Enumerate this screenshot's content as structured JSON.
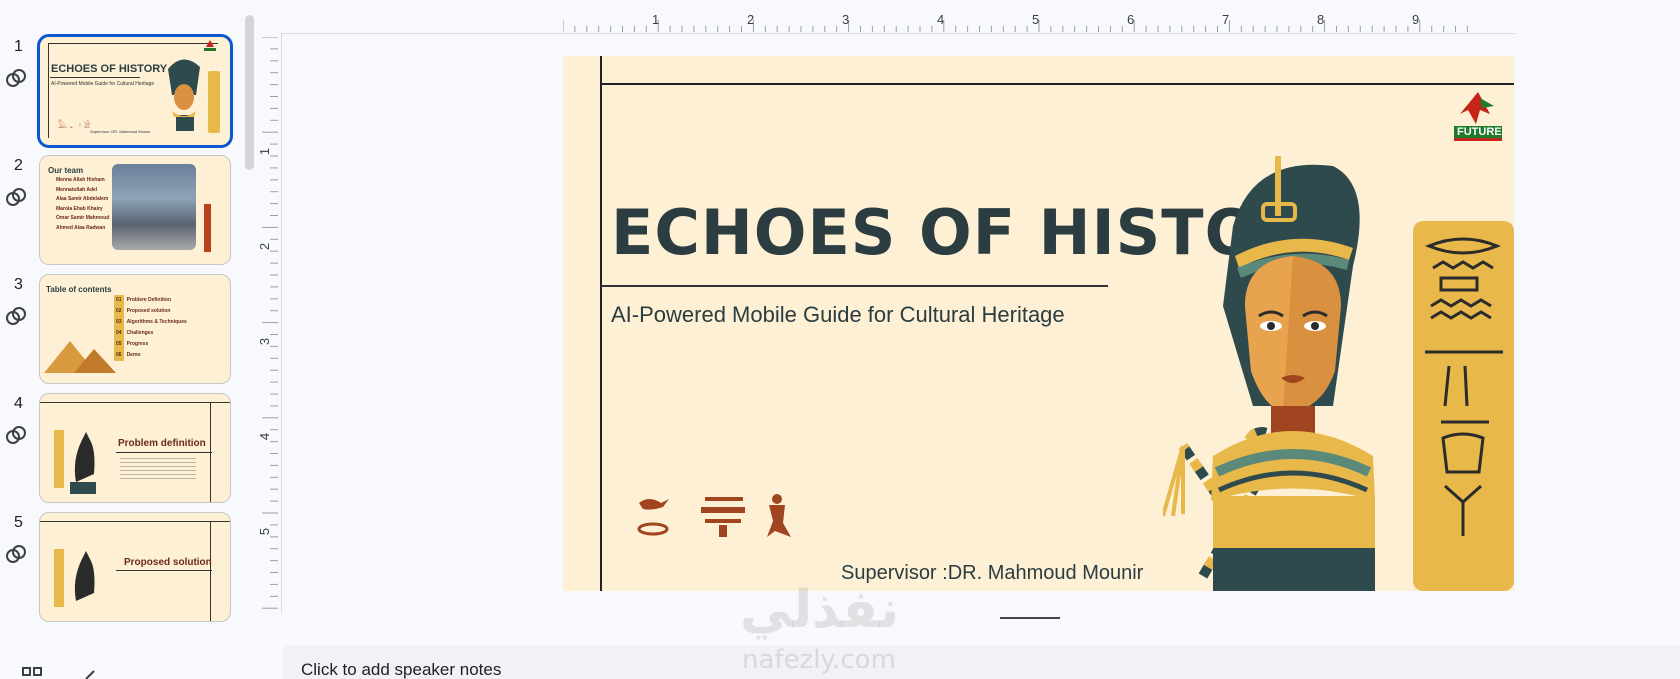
{
  "filmstrip": {
    "slides": [
      {
        "num": "1",
        "title": "ECHOES OF HISTORY",
        "subtitle": "AI-Powered Mobile Guide for Cultural Heritage",
        "footer": "Supervisor :DR. Mahmoud Mounir"
      },
      {
        "num": "2",
        "title": "Our team",
        "members": [
          "Menna Allah Hisham",
          "Mennatullah Adel",
          "Alaa Samir Abdelalem",
          "Marola Ehab Khairy",
          "Omar Samir Mahmoud",
          "Ahmed Alaa Radwan"
        ]
      },
      {
        "num": "3",
        "title": "Table of contents",
        "items": [
          {
            "n": "01",
            "label": "Problem Definition"
          },
          {
            "n": "02",
            "label": "Proposed solution"
          },
          {
            "n": "03",
            "label": "Algorithms & Techniques"
          },
          {
            "n": "04",
            "label": "Challenges"
          },
          {
            "n": "05",
            "label": "Progress"
          },
          {
            "n": "06",
            "label": "Demo"
          }
        ]
      },
      {
        "num": "4",
        "title": "Problem definition"
      },
      {
        "num": "5",
        "title": "Proposed solution"
      }
    ]
  },
  "ruler": {
    "top": [
      "1",
      "2",
      "3",
      "4",
      "5",
      "6",
      "7",
      "8",
      "9"
    ],
    "left": [
      "1",
      "2",
      "3",
      "4",
      "5"
    ]
  },
  "slide": {
    "title": "ECHOES OF HISTORY",
    "subtitle": "AI-Powered Mobile Guide for Cultural Heritage",
    "supervisor": "Supervisor :DR. Mahmoud Mounir",
    "logo_text": "FUTURE"
  },
  "notes": {
    "placeholder": "Click to add speaker notes"
  },
  "watermark": {
    "arabic": "نفذلي",
    "latin": "nafezly.com"
  },
  "colors": {
    "accent": "#0b57d0",
    "slide_bg": "#fdf0d5",
    "title": "#2b3d40"
  }
}
